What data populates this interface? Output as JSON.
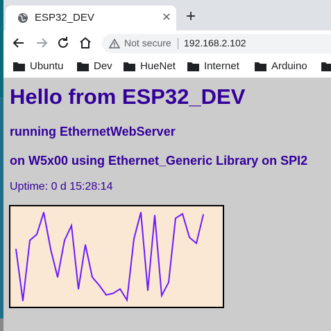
{
  "browser": {
    "tab_title": "ESP32_DEV",
    "new_tab": "+",
    "close_tab": "✕",
    "security_label": "Not secure",
    "url": "192.168.2.102",
    "bookmarks": [
      "Ubuntu",
      "Dev",
      "HueNet",
      "Internet",
      "Arduino"
    ]
  },
  "page": {
    "heading": "Hello from ESP32_DEV",
    "subheading_1": "running EthernetWebServer",
    "subheading_2": "on W5x00 using Ethernet_Generic Library on SPI2",
    "uptime": "Uptime: 0 d 15:28:14"
  },
  "colors": {
    "text": "#330099",
    "page_background": "#cccccc",
    "chart_background": "#fbe8d4",
    "line": "#6a1bff"
  },
  "chart_data": {
    "type": "line",
    "title": "",
    "xlabel": "",
    "ylabel": "",
    "ylim": [
      0,
      140
    ],
    "x": [
      0,
      1,
      2,
      3,
      4,
      5,
      6,
      7,
      8,
      9,
      10,
      11,
      12,
      13,
      14,
      15,
      16,
      17,
      18,
      19,
      20,
      21,
      22,
      23,
      24,
      25,
      26,
      27,
      28,
      29
    ],
    "series": [
      {
        "values": [
          80,
          10,
          92,
          100,
          130,
          80,
          42,
          92,
          112,
          26,
          86,
          42,
          31,
          18,
          20,
          26,
          11,
          94,
          130,
          24,
          126,
          17,
          35,
          122,
          128,
          96,
          88,
          127
        ]
      }
    ]
  }
}
